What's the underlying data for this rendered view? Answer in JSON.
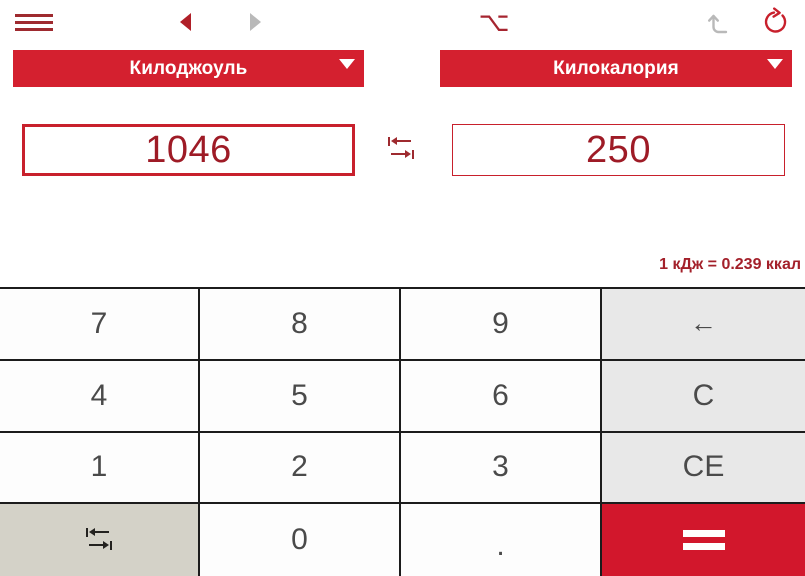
{
  "toolbar": {
    "menu_icon": "hamburger-menu-icon",
    "prev_icon": "triangle-left-icon",
    "next_icon": "triangle-right-icon",
    "option_icon": "option-key-icon",
    "option_glyph": "⌥",
    "undo_icon": "undo-arrow-icon",
    "redo_icon": "redo-arrow-icon",
    "prev_color": "#b01f28",
    "next_color": "#b9b9b9",
    "undo_color": "#b9b9b9",
    "redo_color": "#c8202c"
  },
  "converter": {
    "from": {
      "unit_label": "Килоджоуль",
      "value": "1046",
      "caret_icon": "chevron-down-icon"
    },
    "to": {
      "unit_label": "Килокалория",
      "value": "250",
      "caret_icon": "chevron-down-icon"
    },
    "swap_icon": "swap-arrows-icon",
    "ratio_text": "1 кДж = 0.239 ккал",
    "accent_color": "#d4202f",
    "value_color": "#9e1b26"
  },
  "keypad": {
    "rows": [
      [
        {
          "label": "7",
          "name": "key-7",
          "style": "white"
        },
        {
          "label": "8",
          "name": "key-8",
          "style": "white"
        },
        {
          "label": "9",
          "name": "key-9",
          "style": "white"
        },
        {
          "label": "←",
          "name": "key-backspace",
          "style": "gray"
        }
      ],
      [
        {
          "label": "4",
          "name": "key-4",
          "style": "white"
        },
        {
          "label": "5",
          "name": "key-5",
          "style": "white"
        },
        {
          "label": "6",
          "name": "key-6",
          "style": "white"
        },
        {
          "label": "C",
          "name": "key-clear",
          "style": "gray"
        }
      ],
      [
        {
          "label": "1",
          "name": "key-1",
          "style": "white"
        },
        {
          "label": "2",
          "name": "key-2",
          "style": "white"
        },
        {
          "label": "3",
          "name": "key-3",
          "style": "white"
        },
        {
          "label": "CE",
          "name": "key-clear-entry",
          "style": "gray"
        }
      ],
      [
        {
          "label": "",
          "name": "key-swap",
          "style": "beige"
        },
        {
          "label": "0",
          "name": "key-0",
          "style": "white"
        },
        {
          "label": ".",
          "name": "key-decimal",
          "style": "white"
        },
        {
          "label": "",
          "name": "key-equals",
          "style": "accent"
        }
      ]
    ]
  }
}
